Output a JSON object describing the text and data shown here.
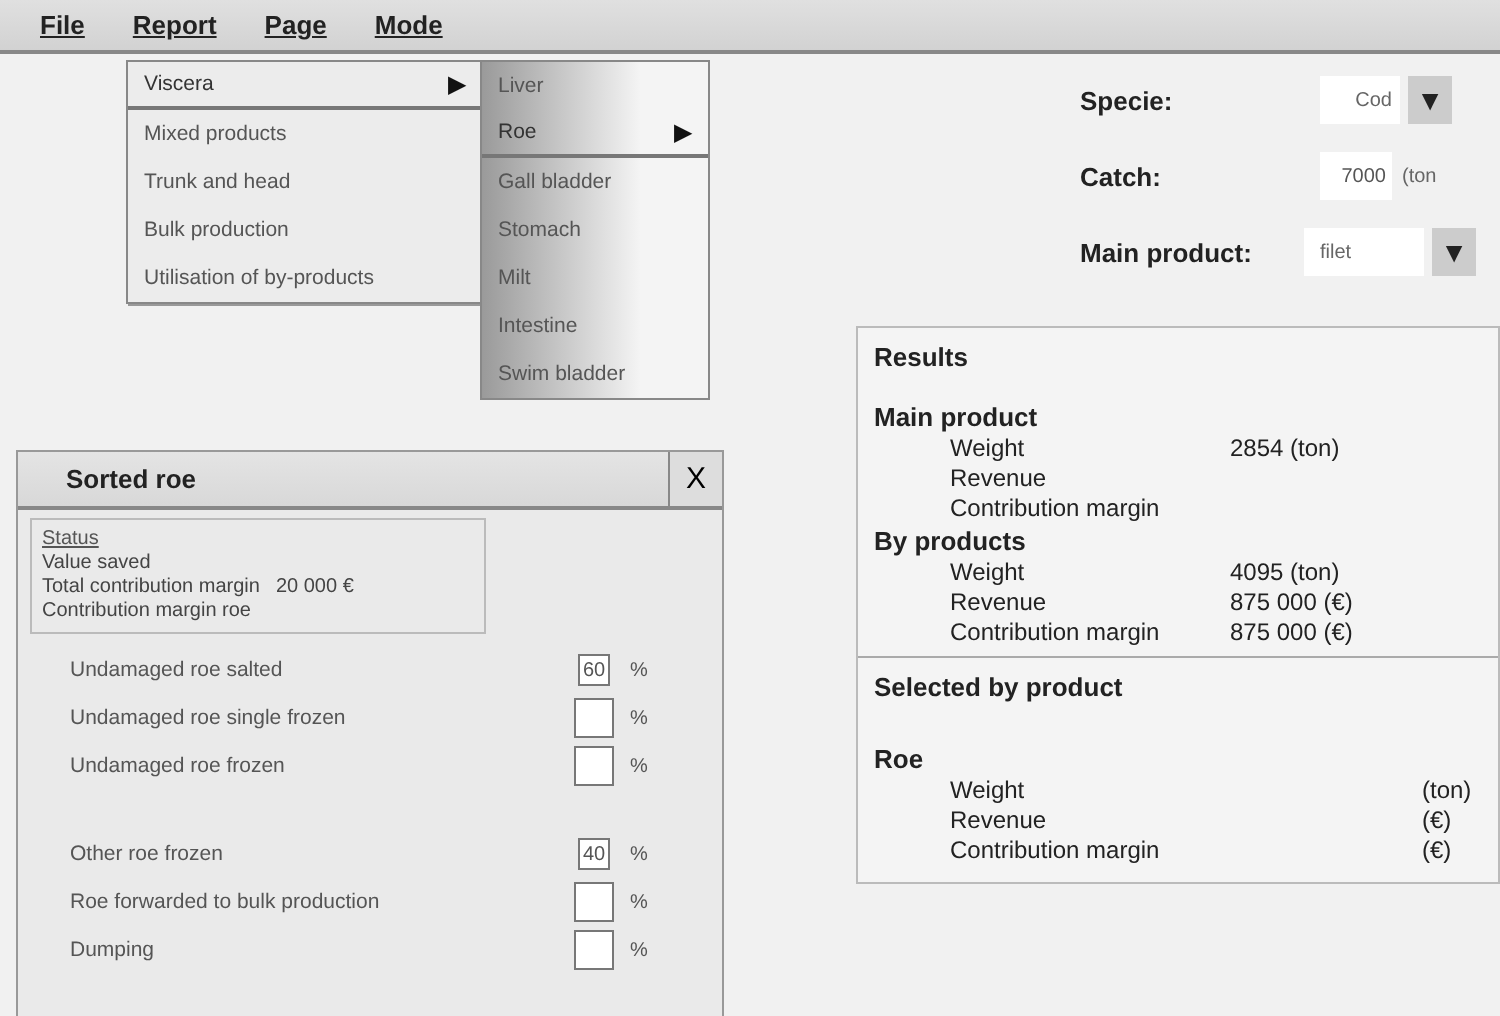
{
  "menu_bar": [
    {
      "label": "File"
    },
    {
      "label": "Report"
    },
    {
      "label": "Page"
    },
    {
      "label": "Mode"
    }
  ],
  "report_menu": [
    {
      "label": "Viscera",
      "selected": true,
      "submenu": "▶"
    },
    {
      "label": "Mixed products",
      "selected": false
    },
    {
      "label": "Trunk and head",
      "selected": false
    },
    {
      "label": "Bulk production",
      "selected": false
    },
    {
      "label": "Utilisation of by-products",
      "selected": false
    }
  ],
  "viscera_menu": [
    {
      "label": "Liver",
      "selected": false
    },
    {
      "label": "Roe",
      "selected": true,
      "submenu": "▶"
    },
    {
      "label": "Gall bladder",
      "selected": false
    },
    {
      "label": "Stomach",
      "selected": false
    },
    {
      "label": "Milt",
      "selected": false
    },
    {
      "label": "Intestine",
      "selected": false
    },
    {
      "label": "Swim bladder",
      "selected": false
    }
  ],
  "inputs": [
    {
      "kind": "dropdown",
      "label": "Specie:",
      "value": "Cod",
      "arrow": "▼"
    },
    {
      "kind": "text",
      "label": "Catch:",
      "value": "7000",
      "unit": "(ton"
    },
    {
      "kind": "dropdown",
      "label": "Main product:",
      "value": "filet",
      "arrow": "▼"
    }
  ],
  "results": {
    "title": "Results",
    "sections": [
      {
        "heading": "Main product",
        "rows": [
          {
            "label": "Weight",
            "value": "2854 (ton)"
          },
          {
            "label": "Revenue"
          },
          {
            "label": "Contribution margin"
          }
        ]
      },
      {
        "heading": "By products",
        "rows": [
          {
            "label": "Weight",
            "value": "4095 (ton)"
          },
          {
            "label": "Revenue",
            "value": "875 000 (€)"
          },
          {
            "label": "Contribution margin",
            "value": "875 000 (€)"
          }
        ]
      }
    ],
    "selected_title": "Selected by product",
    "selected": {
      "heading": "Roe",
      "rows": [
        {
          "label": "Weight",
          "value": "(ton)"
        },
        {
          "label": "Revenue",
          "value": "(€)"
        },
        {
          "label": "Contribution margin",
          "value": "(€)"
        }
      ]
    }
  },
  "dialog": {
    "title": "Sorted roe",
    "close": "X",
    "status": {
      "heading": "Status",
      "lines": [
        "Value saved"
      ],
      "total_label": "Total contribution margin",
      "total_value": "20 000 €",
      "last": "Contribution margin roe"
    },
    "groups": [
      [
        {
          "label": "Undamaged roe salted",
          "value": "60",
          "unit": "%"
        },
        {
          "label": "Undamaged roe single frozen",
          "unit": "%"
        },
        {
          "label": "Undamaged roe frozen",
          "unit": "%"
        }
      ],
      [
        {
          "label": "Other roe frozen",
          "value": "40",
          "unit": "%"
        },
        {
          "label": "Roe forwarded to bulk production",
          "unit": "%"
        },
        {
          "label": "Dumping",
          "unit": "%"
        }
      ]
    ]
  }
}
